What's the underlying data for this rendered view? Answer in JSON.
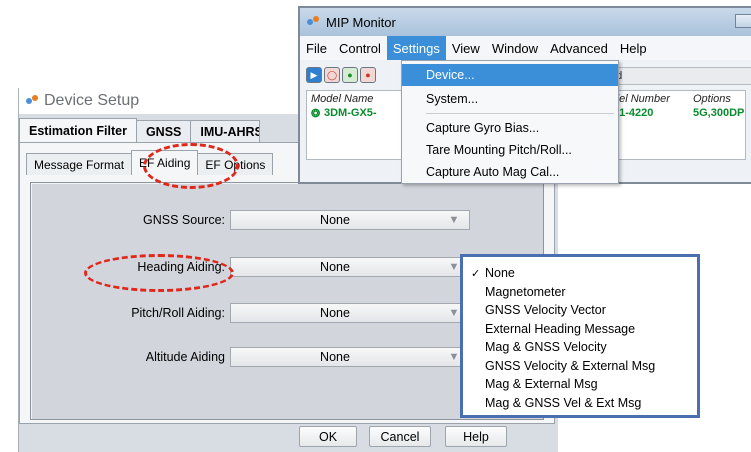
{
  "device_setup": {
    "title": "Device Setup",
    "tabs": [
      {
        "label": "Estimation Filter",
        "active": true
      },
      {
        "label": "GNSS",
        "active": false
      },
      {
        "label": "IMU-AHRS",
        "active": false
      }
    ],
    "subtabs": [
      {
        "label": "Message Format",
        "active": false
      },
      {
        "label": "EF Aiding",
        "active": true
      },
      {
        "label": "EF Options",
        "active": false
      }
    ],
    "fields": [
      {
        "label": "GNSS Source:",
        "value": "None"
      },
      {
        "label": "Heading Aiding:",
        "value": "None"
      },
      {
        "label": "Pitch/Roll Aiding:",
        "value": "None"
      },
      {
        "label": "Altitude Aiding",
        "value": "None"
      }
    ],
    "buttons": {
      "ok": "OK",
      "cancel": "Cancel",
      "help": "Help"
    }
  },
  "mip_monitor": {
    "title": "MIP Monitor",
    "menu": [
      "File",
      "Control",
      "Settings",
      "View",
      "Window",
      "Advanced",
      "Help"
    ],
    "open_menu": "Settings",
    "status_text": "ted",
    "table": {
      "headers": {
        "model_name": "Model Name",
        "model_number": "del Number",
        "options": "Options"
      },
      "row": {
        "model_name": "3DM-GX5-",
        "model_number": "51-4220",
        "options": "5G,300DP"
      }
    },
    "settings_menu": [
      "Device...",
      "System...",
      "Capture Gyro Bias...",
      "Tare Mounting Pitch/Roll...",
      "Capture Auto Mag Cal..."
    ],
    "highlighted_item": "Device..."
  },
  "heading_aiding_options": {
    "selected": "None",
    "options": [
      "None",
      "Magnetometer",
      "GNSS Velocity Vector",
      "External Heading Message",
      "Mag & GNSS Velocity",
      "GNSS Velocity & External Msg",
      "Mag & External Msg",
      "Mag & GNSS Vel & Ext Msg"
    ]
  },
  "icons": {
    "checkmark": "checkmark-icon",
    "dropdown": "chevron-down-icon",
    "play": "play-icon",
    "stop": "stop-icon",
    "record": "record-icon"
  },
  "colors": {
    "highlight_red": "#e0271b",
    "menu_select": "#3b8fd8",
    "device_green": "#0a8b2d",
    "options_border": "#4a6fb0"
  }
}
